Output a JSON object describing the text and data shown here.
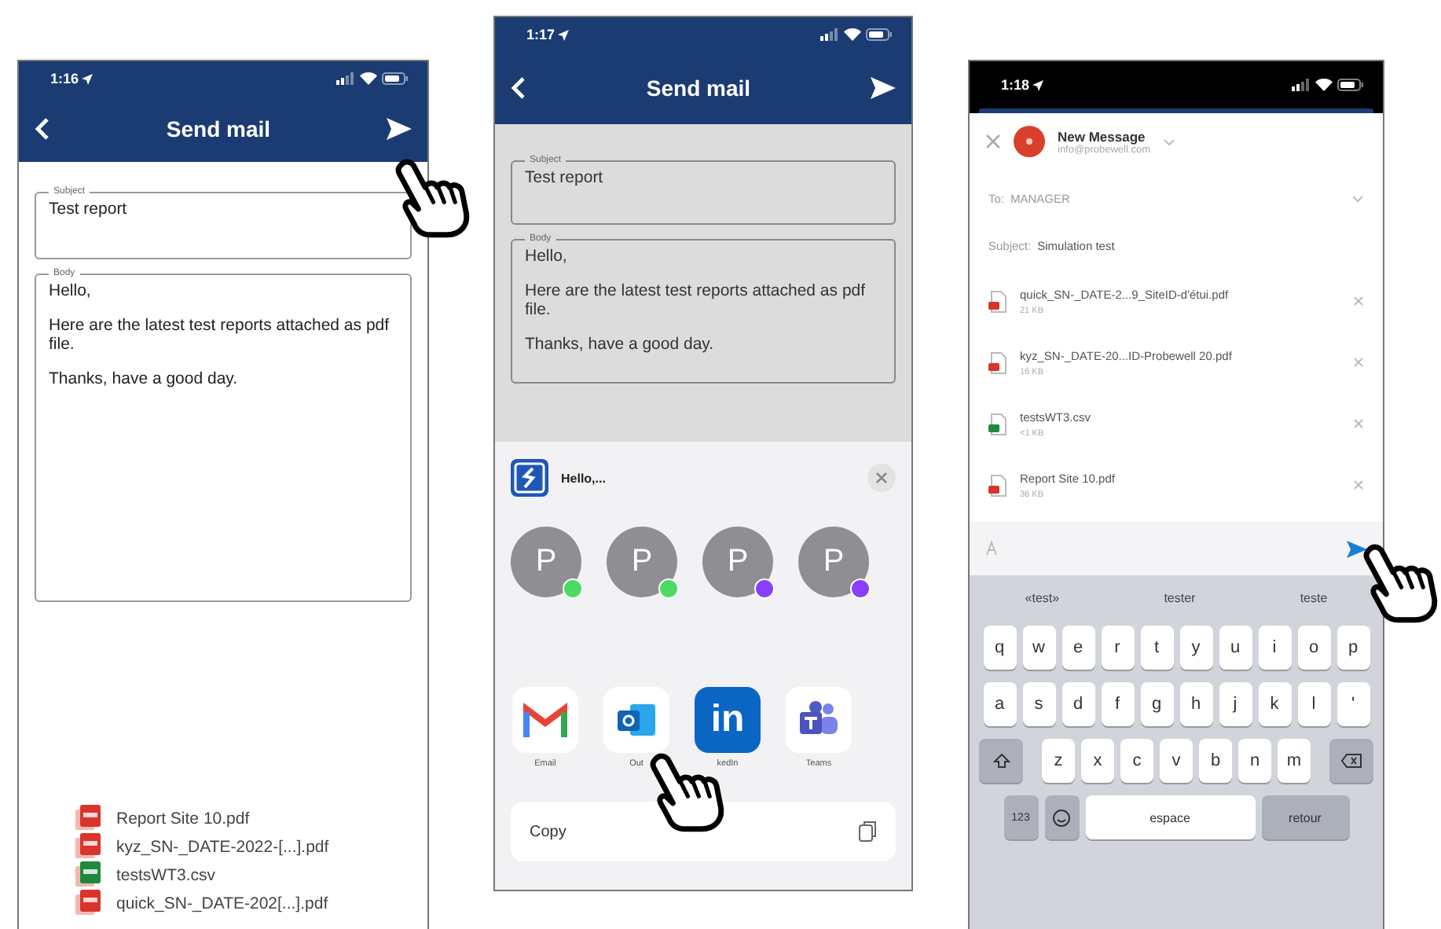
{
  "phones": [
    {
      "kind": "app",
      "time": "1:16",
      "title": "Send mail",
      "subject_label": "Subject",
      "subject": "Test report",
      "body_label": "Body",
      "body": [
        "Hello,",
        "Here are the latest test reports attached as pdf file.",
        "Thanks, have a good day."
      ],
      "attachments": [
        {
          "name": "Report Site 10.pdf",
          "kind": "pdf"
        },
        {
          "name": "kyz_SN-_DATE-2022-[...].pdf",
          "kind": "pdf"
        },
        {
          "name": "testsWT3.csv",
          "kind": "csv"
        },
        {
          "name": "quick_SN-_DATE-202[...].pdf",
          "kind": "pdf"
        }
      ]
    },
    {
      "kind": "share",
      "time": "1:17",
      "title": "Send mail",
      "subject_label": "Subject",
      "subject": "Test report",
      "body_label": "Body",
      "body": [
        "Hello,",
        "Here are the latest test reports attached as pdf file.",
        "Thanks, have a good day."
      ],
      "share_sheet": {
        "preview": "Hello,...",
        "contacts": [
          {
            "initial": "P",
            "color": "#4cd964"
          },
          {
            "initial": "P",
            "color": "#4cd964"
          },
          {
            "initial": "P",
            "color": "#8a3ffc"
          },
          {
            "initial": "P",
            "color": "#8a3ffc"
          }
        ],
        "apps": [
          {
            "kind": "gmail",
            "label": "Email"
          },
          {
            "kind": "outlook",
            "label": "Out"
          },
          {
            "kind": "linkedin",
            "label": "kedIn",
            "icon_text": "in"
          },
          {
            "kind": "teams",
            "label": "Teams"
          }
        ],
        "action": "Copy"
      }
    },
    {
      "kind": "compose",
      "time": "1:18",
      "title": "New Message",
      "sender": "info@probewell.com",
      "to_label": "To:",
      "to": "MANAGER",
      "subject_label": "Subject:",
      "subject": "Simulation test",
      "attachments": [
        {
          "name": "quick_SN-_DATE-2...9_SiteID-d'étui.pdf",
          "size": "21 KB",
          "kind": "pdf"
        },
        {
          "name": "kyz_SN-_DATE-20...ID-Probewell 20.pdf",
          "size": "16 KB",
          "kind": "pdf"
        },
        {
          "name": "testsWT3.csv",
          "size": "<1 KB",
          "kind": "csv"
        },
        {
          "name": "Report Site 10.pdf",
          "size": "36 KB",
          "kind": "pdf"
        }
      ],
      "suggestions": [
        "«test»",
        "tester",
        "teste"
      ],
      "keyboard": {
        "rows": [
          [
            "q",
            "w",
            "e",
            "r",
            "t",
            "y",
            "u",
            "i",
            "o",
            "p"
          ],
          [
            "a",
            "s",
            "d",
            "f",
            "g",
            "h",
            "j",
            "k",
            "l",
            "'"
          ],
          [
            "z",
            "x",
            "c",
            "v",
            "b",
            "n",
            "m"
          ]
        ],
        "numbers_key": "123",
        "space_key": "espace",
        "return_key": "retour"
      }
    }
  ]
}
